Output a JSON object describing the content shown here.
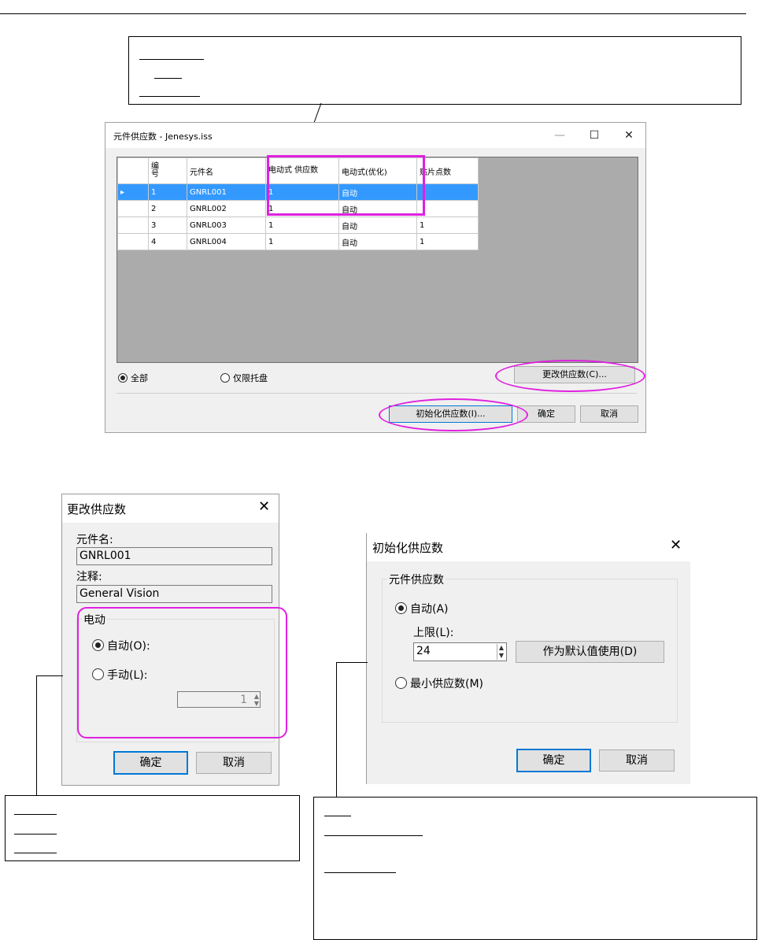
{
  "main_window": {
    "title": "元件供应数 - Jenesys.iss",
    "minimize": "—",
    "maximize": "☐",
    "close": "✕",
    "columns": [
      "编号",
      "元件名",
      "电动式 供应数",
      "电动式(优化)",
      "贴片点数"
    ],
    "rows": [
      {
        "no": "1",
        "name": "GNRL001",
        "qty": "1",
        "opt": "自动",
        "points": ""
      },
      {
        "no": "2",
        "name": "GNRL002",
        "qty": "1",
        "opt": "自动",
        "points": ""
      },
      {
        "no": "3",
        "name": "GNRL003",
        "qty": "1",
        "opt": "自动",
        "points": "1"
      },
      {
        "no": "4",
        "name": "GNRL004",
        "qty": "1",
        "opt": "自动",
        "points": "1"
      }
    ],
    "selected_row": 0,
    "radio_all": "全部",
    "radio_tray": "仅限托盘",
    "change_button": "更改供应数(C)...",
    "init_button": "初始化供应数(I)...",
    "ok_button": "确定",
    "cancel_button": "取消"
  },
  "change_dialog": {
    "title": "更改供应数",
    "part_name_label": "元件名:",
    "part_name_value": "GNRL001",
    "comment_label": "注释:",
    "comment_value": "General Vision",
    "group_label": "电动",
    "auto_label": "自动(O):",
    "manual_label": "手动(L):",
    "manual_value": "1",
    "ok_button": "确定",
    "cancel_button": "取消"
  },
  "init_dialog": {
    "title": "初始化供应数",
    "group_label": "元件供应数",
    "auto_label": "自动(A)",
    "upper_label": "上限(L):",
    "upper_value": "24",
    "default_button": "作为默认值使用(D)",
    "min_label": "最小供应数(M)",
    "ok_button": "确定",
    "cancel_button": "取消"
  }
}
